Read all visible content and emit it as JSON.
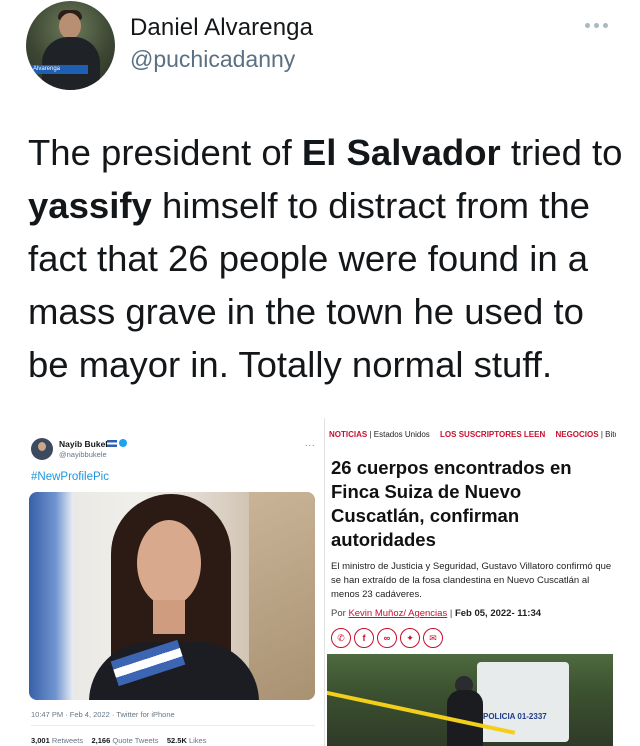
{
  "tweet": {
    "display_name": "Daniel Alvarenga",
    "handle": "@puchicadanny",
    "avatar_tag": "Alvarenga",
    "text_parts": [
      "The president of ",
      "El Salvador",
      " tried to ",
      "yassify",
      " himself to distract from the fact that 26 people were found in a mass grave in the town he used to be mayor in. Totally normal stuff."
    ]
  },
  "embedded_tweet": {
    "name": "Nayib Bukele",
    "handle": "@nayibbukele",
    "more": "...",
    "hashtag": "#NewProfilePic",
    "meta": "10:47 PM · Feb 4, 2022 · Twitter for iPhone",
    "retweets": "3,001",
    "retweets_label": "Retweets",
    "quotes": "2,166",
    "quotes_label": "Quote Tweets",
    "likes": "52.5K",
    "likes_label": "Likes"
  },
  "article": {
    "nav_noticias": "NOTICIAS",
    "nav_estados": "Estados Unidos",
    "nav_suscriptores": "LOS SUSCRIPTORES LEEN",
    "nav_negocios": "NEGOCIOS",
    "nav_bitcoin": "Bitcoi...",
    "headline": "26 cuerpos encontrados en Finca Suiza de Nuevo Cuscatlán, confirman autoridades",
    "lead": "El ministro de Justicia y Seguridad, Gustavo Villatoro confirmó que se han extraído de la fosa clandestina en Nuevo Cuscatlán al menos 23 cadáveres.",
    "byline_prefix": "Por",
    "author": "Kevin Muñoz/ Agencias",
    "date": "Feb 05, 2022- 11:34",
    "share_icons": [
      "whatsapp-icon",
      "facebook-icon",
      "link-icon",
      "twitter-icon",
      "messenger-icon"
    ],
    "photo_text": "POLICIA  01-2337"
  }
}
